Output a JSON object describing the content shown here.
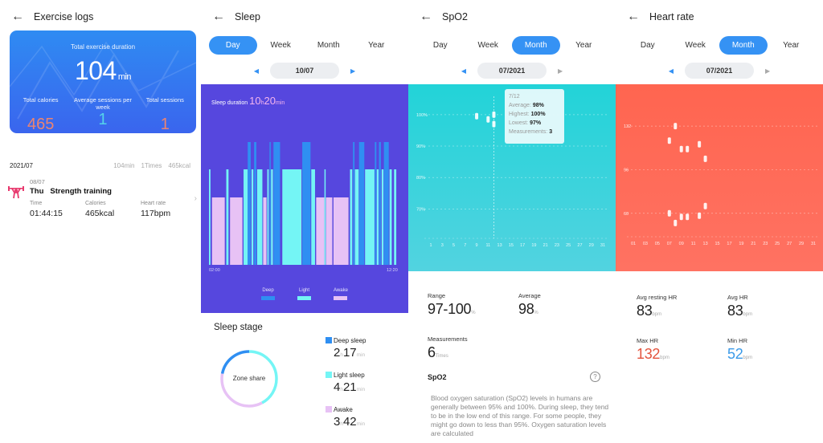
{
  "exercise": {
    "title": "Exercise logs",
    "card": {
      "duration_label": "Total exercise duration",
      "duration_value": "104",
      "duration_unit": "min",
      "stats": [
        {
          "label": "Total calories",
          "value": "465"
        },
        {
          "label": "Average sessions per week",
          "value": "1"
        },
        {
          "label": "Total sessions",
          "value": "1"
        }
      ]
    },
    "month": {
      "label": "2021/07",
      "minutes": "104min",
      "times": "1Times",
      "kcal": "465kcal"
    },
    "log": {
      "date": "08/07",
      "weekday": "Thu",
      "name": "Strength training",
      "icon": "weightlifting-icon",
      "time_label": "Time",
      "time_value": "01:44:15",
      "calories_label": "Calories",
      "calories_value": "465kcal",
      "hr_label": "Heart rate",
      "hr_value": "117bpm"
    }
  },
  "sleep": {
    "title": "Sleep",
    "tabs": [
      "Day",
      "Week",
      "Month",
      "Year"
    ],
    "active_tab": "Day",
    "date": "10/07",
    "duration_label": "Sleep duration",
    "duration_h": "10",
    "duration_h_unit": "h",
    "duration_m": "20",
    "duration_m_unit": "min",
    "axis_start": "02:00",
    "axis_end": "12:20",
    "legend": [
      {
        "label": "Deep",
        "color": "#2f8ff2"
      },
      {
        "label": "Light",
        "color": "#74f5f5"
      },
      {
        "label": "Awake",
        "color": "#e7c2f5"
      }
    ],
    "stage_title": "Sleep stage",
    "zone_label": "Zone share",
    "stages": [
      {
        "label": "Deep sleep",
        "h": "2",
        "m": "17",
        "color": "#2f8ff2",
        "minutes": 137
      },
      {
        "label": "Light sleep",
        "h": "4",
        "m": "21",
        "color": "#74f5f5",
        "minutes": 261
      },
      {
        "label": "Awake",
        "h": "3",
        "m": "42",
        "color": "#e7c2f5",
        "minutes": 222
      }
    ],
    "h_unit": "h",
    "min_unit": "min"
  },
  "spo2": {
    "title": "SpO2",
    "tabs": [
      "Day",
      "Week",
      "Month",
      "Year"
    ],
    "active_tab": "Month",
    "date": "07/2021",
    "tooltip": {
      "date": "7/12",
      "average_label": "Average:",
      "average": "98%",
      "highest_label": "Highest:",
      "highest": "100%",
      "lowest_label": "Lowest:",
      "lowest": "97%",
      "measurements_label": "Measurements:",
      "measurements": "3"
    },
    "range_label": "Range",
    "range_value": "97-100",
    "range_unit": "%",
    "average_label": "Average",
    "average_value": "98",
    "average_unit": "%",
    "measurements_label": "Measurements",
    "measurements_value": "6",
    "measurements_unit": "Times",
    "info_title": "SpO2",
    "info_text": "Blood oxygen saturation (SpO2) levels in humans are generally between 95% and 100%. During sleep, they tend to be in the low end of this range. For some people, they might go down to less than 95%. Oxygen saturation levels are calculated"
  },
  "heart": {
    "title": "Heart rate",
    "tabs": [
      "Day",
      "Week",
      "Month",
      "Year"
    ],
    "active_tab": "Month",
    "date": "07/2021",
    "avg_rest_label": "Avg resting HR",
    "avg_rest_value": "83",
    "avg_label": "Avg HR",
    "avg_value": "83",
    "max_label": "Max HR",
    "max_value": "132",
    "min_label": "Min HR",
    "min_value": "52",
    "unit": "bpm"
  },
  "chart_data": [
    {
      "type": "bar",
      "title": "Sleep duration 10h20min",
      "xlabel": "",
      "ylabel": "",
      "x_range": [
        "02:00",
        "12:20"
      ],
      "levels": {
        "Awake": 1,
        "Light": 2,
        "Deep": 3
      },
      "segments": [
        {
          "stage": "Light",
          "start": 0.0,
          "end": 0.008
        },
        {
          "stage": "Awake",
          "start": 0.016,
          "end": 0.084
        },
        {
          "stage": "Light",
          "start": 0.092,
          "end": 0.104
        },
        {
          "stage": "Awake",
          "start": 0.112,
          "end": 0.178
        },
        {
          "stage": "Light",
          "start": 0.184,
          "end": 0.206
        },
        {
          "stage": "Deep",
          "start": 0.206,
          "end": 0.222
        },
        {
          "stage": "Light",
          "start": 0.226,
          "end": 0.236
        },
        {
          "stage": "Deep",
          "start": 0.24,
          "end": 0.252
        },
        {
          "stage": "Light",
          "start": 0.256,
          "end": 0.284
        },
        {
          "stage": "Awake",
          "start": 0.288,
          "end": 0.306
        },
        {
          "stage": "Light",
          "start": 0.31,
          "end": 0.318
        },
        {
          "stage": "Deep",
          "start": 0.322,
          "end": 0.328
        },
        {
          "stage": "Light",
          "start": 0.33,
          "end": 0.34
        },
        {
          "stage": "Deep",
          "start": 0.343,
          "end": 0.378
        },
        {
          "stage": "Light",
          "start": 0.39,
          "end": 0.492
        },
        {
          "stage": "Deep",
          "start": 0.496,
          "end": 0.54
        },
        {
          "stage": "Light",
          "start": 0.544,
          "end": 0.564
        },
        {
          "stage": "Awake",
          "start": 0.57,
          "end": 0.614
        },
        {
          "stage": "Light",
          "start": 0.614,
          "end": 0.618
        },
        {
          "stage": "Awake",
          "start": 0.622,
          "end": 0.656
        },
        {
          "stage": "Awake",
          "start": 0.662,
          "end": 0.742
        },
        {
          "stage": "Light",
          "start": 0.75,
          "end": 0.762
        },
        {
          "stage": "Deep",
          "start": 0.766,
          "end": 0.774
        },
        {
          "stage": "Light",
          "start": 0.776,
          "end": 0.796
        },
        {
          "stage": "Deep",
          "start": 0.798,
          "end": 0.826
        },
        {
          "stage": "Light",
          "start": 0.83,
          "end": 0.88
        },
        {
          "stage": "Deep",
          "start": 0.882,
          "end": 0.89
        },
        {
          "stage": "Light",
          "start": 0.892,
          "end": 0.902
        },
        {
          "stage": "Deep",
          "start": 0.904,
          "end": 0.914
        },
        {
          "stage": "Light",
          "start": 0.918,
          "end": 0.928
        },
        {
          "stage": "Deep",
          "start": 0.93,
          "end": 0.956
        },
        {
          "stage": "Light",
          "start": 0.96,
          "end": 0.972
        },
        {
          "stage": "Light",
          "start": 0.984,
          "end": 0.996
        }
      ],
      "legend": [
        "Deep",
        "Light",
        "Awake"
      ],
      "legend_position": "bottom"
    },
    {
      "type": "scatter",
      "title": "SpO2 07/2021",
      "xlabel": "",
      "ylabel": "",
      "x_ticks": [
        "1",
        "3",
        "5",
        "7",
        "9",
        "11",
        "13",
        "15",
        "17",
        "19",
        "21",
        "23",
        "25",
        "27",
        "29",
        "31"
      ],
      "y_ticks": [
        "100%",
        "90%",
        "80%",
        "70%"
      ],
      "ylim": [
        65,
        102
      ],
      "points": [
        {
          "day": 9,
          "value": 99.5
        },
        {
          "day": 11,
          "value": 98.5
        },
        {
          "day": 12,
          "value": 100
        },
        {
          "day": 12,
          "value": 97
        }
      ],
      "highlight_day": 12,
      "grid": true
    },
    {
      "type": "scatter",
      "title": "Heart rate 07/2021",
      "xlabel": "",
      "ylabel": "",
      "x_ticks": [
        "01",
        "03",
        "05",
        "07",
        "09",
        "11",
        "13",
        "15",
        "17",
        "19",
        "21",
        "23",
        "25",
        "27",
        "29",
        "31"
      ],
      "y_ticks": [
        "132",
        "96",
        "60"
      ],
      "ylim": [
        30,
        150
      ],
      "points": [
        {
          "day": 7,
          "value": 120
        },
        {
          "day": 7,
          "value": 60
        },
        {
          "day": 8,
          "value": 132
        },
        {
          "day": 8,
          "value": 52
        },
        {
          "day": 9,
          "value": 113
        },
        {
          "day": 9,
          "value": 57
        },
        {
          "day": 10,
          "value": 113
        },
        {
          "day": 10,
          "value": 57
        },
        {
          "day": 12,
          "value": 117
        },
        {
          "day": 12,
          "value": 58
        },
        {
          "day": 13,
          "value": 105
        },
        {
          "day": 13,
          "value": 66
        }
      ],
      "grid": true
    }
  ]
}
